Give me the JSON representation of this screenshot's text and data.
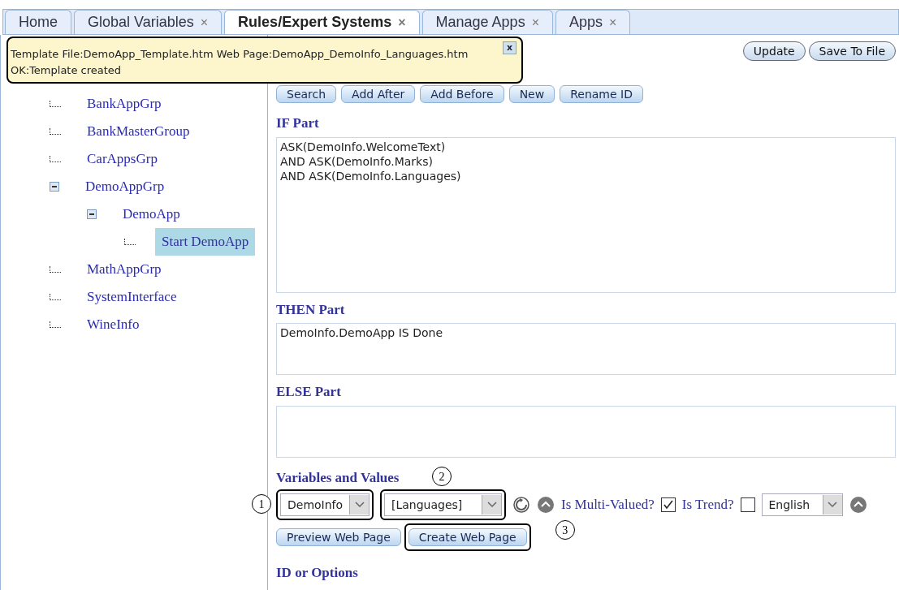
{
  "tabs": [
    {
      "label": "Home",
      "selected": false,
      "closable": false
    },
    {
      "label": "Global Variables",
      "selected": false,
      "closable": true
    },
    {
      "label": "Rules/Expert Systems",
      "selected": true,
      "closable": true
    },
    {
      "label": "Manage Apps",
      "selected": false,
      "closable": true
    },
    {
      "label": "Apps",
      "selected": false,
      "closable": true
    }
  ],
  "close_glyph": "×",
  "notification": {
    "message": "Template File:DemoApp_Template.htm Web Page:DemoApp_DemoInfo_Languages.htm OK:Template created",
    "close": "x"
  },
  "tree": [
    {
      "label": "BankAppGrp",
      "selected": false
    },
    {
      "label": "BankMasterGroup",
      "selected": false
    },
    {
      "label": "CarAppsGrp",
      "selected": false
    },
    {
      "label": "DemoAppGrp",
      "expanded": true,
      "selected": false,
      "children": [
        {
          "label": "DemoApp",
          "expanded": true,
          "selected": false,
          "children": [
            {
              "label": "Start DemoApp",
              "selected": true
            }
          ]
        }
      ]
    },
    {
      "label": "MathAppGrp",
      "selected": false
    },
    {
      "label": "SystemInterface",
      "selected": false
    },
    {
      "label": "WineInfo",
      "selected": false
    }
  ],
  "top_buttons": [
    "Update",
    "Save To File"
  ],
  "rule_buttons": [
    "Search",
    "Add After",
    "Add Before",
    "New",
    "Rename ID"
  ],
  "if_part": {
    "label": "IF Part",
    "lines": [
      "ASK(DemoInfo.WelcomeText)",
      "AND ASK(DemoInfo.Marks)",
      "AND ASK(DemoInfo.Languages)"
    ]
  },
  "then_part": {
    "label": "THEN Part",
    "lines": [
      "DemoInfo.DemoApp IS Done"
    ]
  },
  "else_part": {
    "label": "ELSE Part"
  },
  "variables": {
    "label": "Variables and Values",
    "object_select": {
      "value": "DemoInfo",
      "callout": "1"
    },
    "variable_select": {
      "value": "[Languages]",
      "callout": "2"
    },
    "multi_valued": {
      "label": "Is Multi-Valued?",
      "checked": true
    },
    "trend": {
      "label": "Is Trend?",
      "checked": false
    },
    "language_select": {
      "value": "English"
    }
  },
  "page_buttons": [
    {
      "label": "Preview Web Page"
    },
    {
      "label": "Create Web Page",
      "callout": "3"
    }
  ],
  "id_options": {
    "label": "ID or Options"
  }
}
